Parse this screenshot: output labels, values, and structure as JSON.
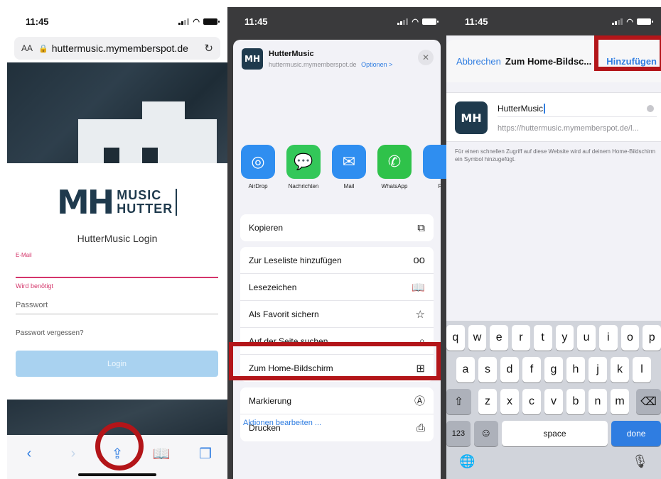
{
  "screen1": {
    "time": "11:45",
    "url_aa": "AA",
    "url": "huttermusic.mymemberspot.de",
    "logo_mark": "MH",
    "logo_line1": "MUSIC",
    "logo_line2": "HUTTER",
    "login_title": "HutterMusic Login",
    "email_label": "E-Mail",
    "error_text": "Wird benötigt",
    "password_placeholder": "Passwort",
    "forgot": "Passwort vergessen?",
    "login_button": "Login"
  },
  "screen2": {
    "time": "11:45",
    "app_name": "HutterMusic",
    "app_url": "huttermusic.mymemberspot.de",
    "options": "Optionen >",
    "apps": [
      {
        "label": "AirDrop",
        "icon": "airdrop-icon",
        "color": "#2f8ef0"
      },
      {
        "label": "Nachrichten",
        "icon": "messages-icon",
        "color": "#33c759"
      },
      {
        "label": "Mail",
        "icon": "mail-icon",
        "color": "#2f8ef0"
      },
      {
        "label": "WhatsApp",
        "icon": "whatsapp-icon",
        "color": "#2fc24a"
      },
      {
        "label": "F",
        "icon": "more-app-icon",
        "color": "#2f8ef0"
      }
    ],
    "group1": [
      {
        "label": "Kopieren",
        "icon": "copy-icon"
      }
    ],
    "group2": [
      {
        "label": "Zur Leseliste hinzufügen",
        "icon": "glasses-icon"
      },
      {
        "label": "Lesezeichen",
        "icon": "book-icon"
      },
      {
        "label": "Als Favorit sichern",
        "icon": "star-icon"
      },
      {
        "label": "Auf der Seite suchen",
        "icon": "search-icon"
      },
      {
        "label": "Zum Home-Bildschirm",
        "icon": "add-square-icon"
      }
    ],
    "group3": [
      {
        "label": "Markierung",
        "icon": "markup-icon"
      },
      {
        "label": "Drucken",
        "icon": "print-icon"
      }
    ],
    "edit_actions": "Aktionen bearbeiten ..."
  },
  "screen3": {
    "time": "11:45",
    "cancel": "Abbrechen",
    "title": "Zum Home-Bildsc...",
    "add": "Hinzufügen",
    "icon_mark": "MH",
    "name_value": "HutterMusic",
    "url_value": "https://huttermusic.mymemberspot.de/l...",
    "description": "Für einen schnellen Zugriff auf diese Website wird auf deinem Home-Bildschirm ein Symbol hinzugefügt.",
    "keyboard": {
      "row1": [
        "q",
        "w",
        "e",
        "r",
        "t",
        "y",
        "u",
        "i",
        "o",
        "p"
      ],
      "row2": [
        "a",
        "s",
        "d",
        "f",
        "g",
        "h",
        "j",
        "k",
        "l"
      ],
      "row3": [
        "z",
        "x",
        "c",
        "v",
        "b",
        "n",
        "m"
      ],
      "num_key": "123",
      "space": "space",
      "done": "done"
    }
  },
  "colors": {
    "highlight": "#b31519",
    "ios_blue": "#2f7de1",
    "brand": "#1f3a4d",
    "error_pink": "#d4356a"
  }
}
